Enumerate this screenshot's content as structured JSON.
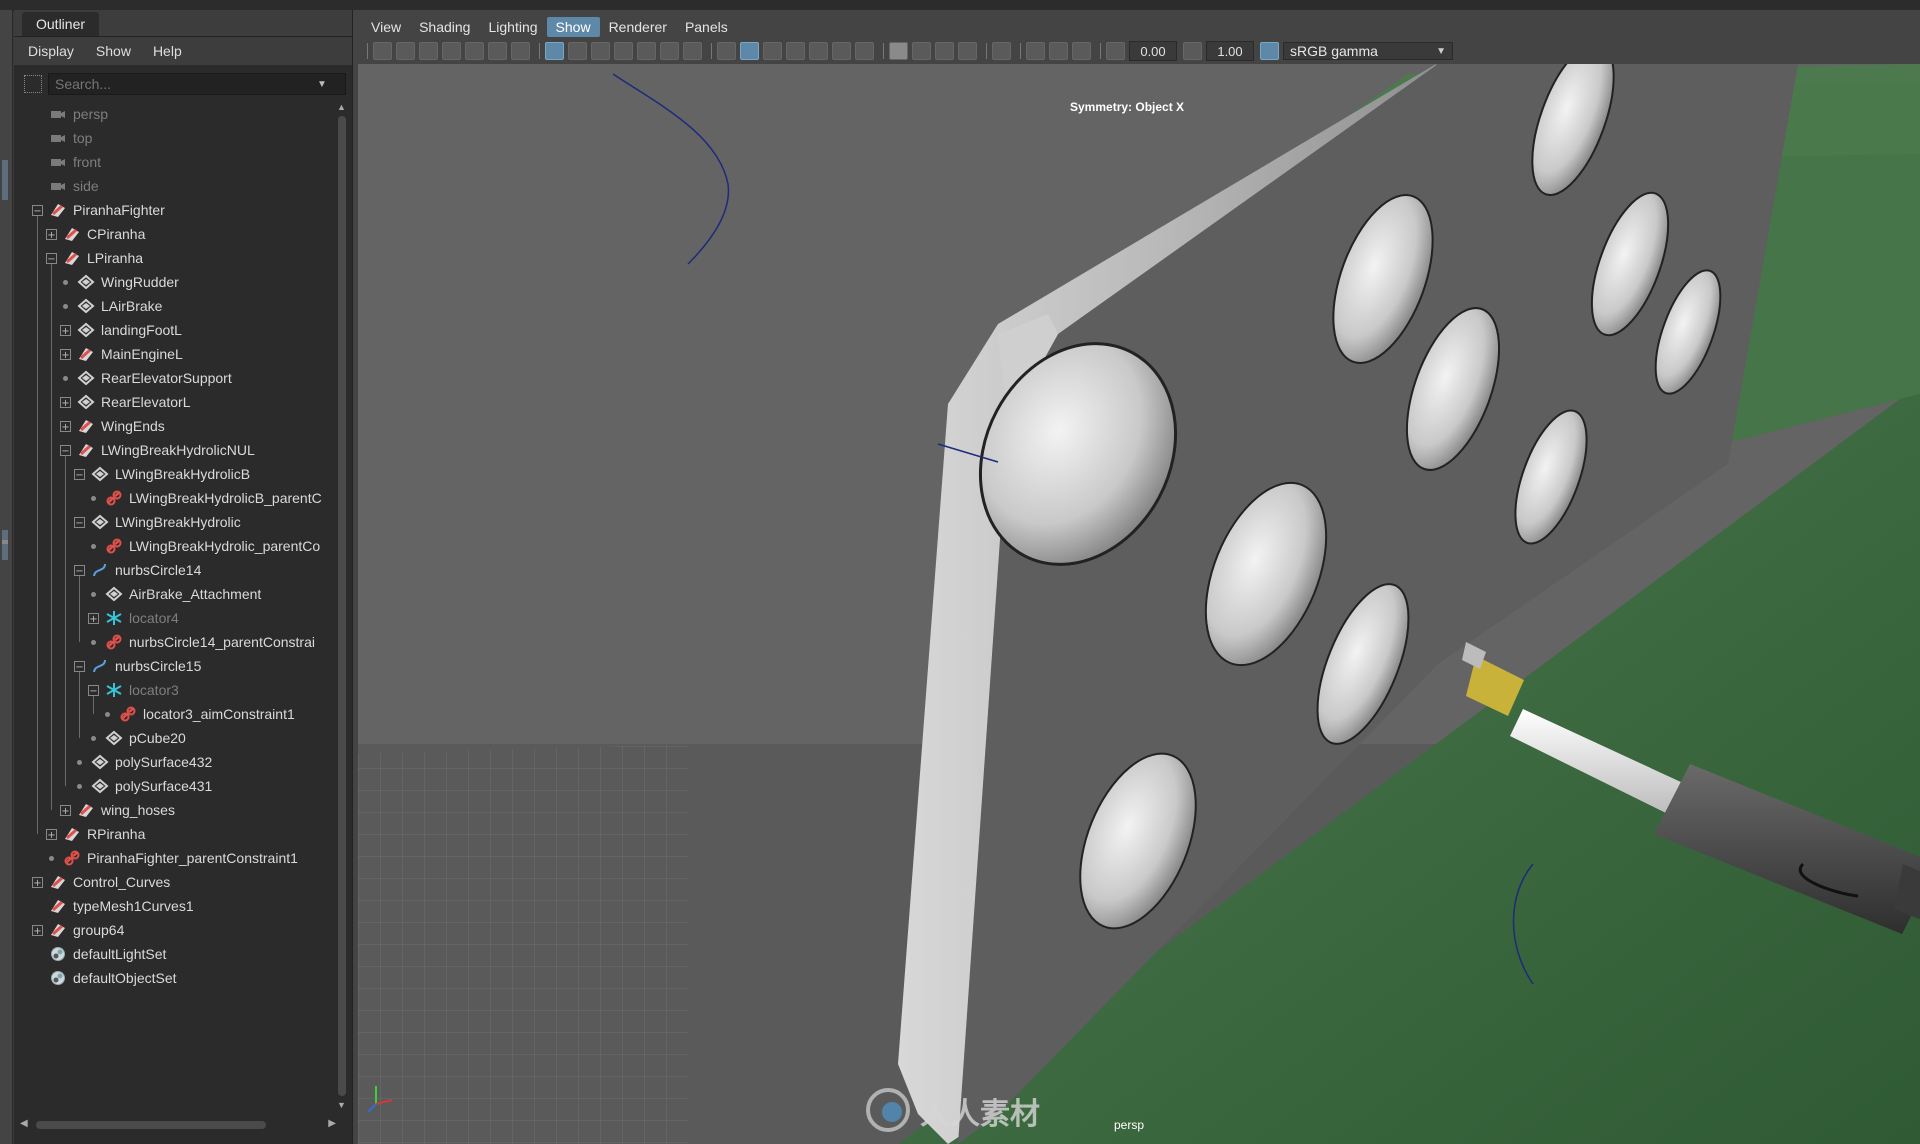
{
  "outliner": {
    "tab_title": "Outliner",
    "menus": [
      "Display",
      "Show",
      "Help"
    ],
    "search_placeholder": "Search...",
    "rows": [
      {
        "label": "persp",
        "icon": "camera",
        "level": 0,
        "expander": "none",
        "dim": true
      },
      {
        "label": "top",
        "icon": "camera",
        "level": 0,
        "expander": "none",
        "dim": true
      },
      {
        "label": "front",
        "icon": "camera",
        "level": 0,
        "expander": "none",
        "dim": true
      },
      {
        "label": "side",
        "icon": "camera",
        "level": 0,
        "expander": "none",
        "dim": true
      },
      {
        "label": "PiranhaFighter",
        "icon": "transform",
        "level": 0,
        "expander": "minus",
        "dim": false
      },
      {
        "label": "CPiranha",
        "icon": "transform",
        "level": 1,
        "expander": "plus",
        "dim": false
      },
      {
        "label": "LPiranha",
        "icon": "transform",
        "level": 1,
        "expander": "minus",
        "dim": false
      },
      {
        "label": "WingRudder",
        "icon": "mesh",
        "level": 2,
        "expander": "dot",
        "dim": false
      },
      {
        "label": "LAirBrake",
        "icon": "mesh",
        "level": 2,
        "expander": "dot",
        "dim": false
      },
      {
        "label": "landingFootL",
        "icon": "mesh",
        "level": 2,
        "expander": "plus",
        "dim": false
      },
      {
        "label": "MainEngineL",
        "icon": "transform",
        "level": 2,
        "expander": "plus",
        "dim": false
      },
      {
        "label": "RearElevatorSupport",
        "icon": "mesh",
        "level": 2,
        "expander": "dot",
        "dim": false
      },
      {
        "label": "RearElevatorL",
        "icon": "mesh",
        "level": 2,
        "expander": "plus",
        "dim": false
      },
      {
        "label": "WingEnds",
        "icon": "transform",
        "level": 2,
        "expander": "plus",
        "dim": false
      },
      {
        "label": "LWingBreakHydrolicNUL",
        "icon": "transform",
        "level": 2,
        "expander": "minus",
        "dim": false
      },
      {
        "label": "LWingBreakHydrolicB",
        "icon": "mesh",
        "level": 3,
        "expander": "minus",
        "dim": false
      },
      {
        "label": "LWingBreakHydrolicB_parentC",
        "icon": "constraint",
        "level": 4,
        "expander": "dot",
        "dim": false
      },
      {
        "label": "LWingBreakHydrolic",
        "icon": "mesh",
        "level": 3,
        "expander": "minus",
        "dim": false
      },
      {
        "label": "LWingBreakHydrolic_parentCo",
        "icon": "constraint",
        "level": 4,
        "expander": "dot",
        "dim": false
      },
      {
        "label": "nurbsCircle14",
        "icon": "curve",
        "level": 3,
        "expander": "minus",
        "dim": false
      },
      {
        "label": "AirBrake_Attachment",
        "icon": "mesh",
        "level": 4,
        "expander": "dot",
        "dim": false
      },
      {
        "label": "locator4",
        "icon": "locator",
        "level": 4,
        "expander": "plus",
        "dim": true
      },
      {
        "label": "nurbsCircle14_parentConstrai",
        "icon": "constraint",
        "level": 4,
        "expander": "dot",
        "dim": false
      },
      {
        "label": "nurbsCircle15",
        "icon": "curve",
        "level": 3,
        "expander": "minus",
        "dim": false
      },
      {
        "label": "locator3",
        "icon": "locator",
        "level": 4,
        "expander": "minus",
        "dim": true
      },
      {
        "label": "locator3_aimConstraint1",
        "icon": "constraint",
        "level": 5,
        "expander": "dot",
        "dim": false
      },
      {
        "label": "pCube20",
        "icon": "mesh",
        "level": 4,
        "expander": "dot",
        "dim": false
      },
      {
        "label": "polySurface432",
        "icon": "mesh",
        "level": 3,
        "expander": "dot",
        "dim": false
      },
      {
        "label": "polySurface431",
        "icon": "mesh",
        "level": 3,
        "expander": "dot",
        "dim": false
      },
      {
        "label": "wing_hoses",
        "icon": "transform",
        "level": 2,
        "expander": "plus",
        "dim": false
      },
      {
        "label": "RPiranha",
        "icon": "transform",
        "level": 1,
        "expander": "plus",
        "dim": false
      },
      {
        "label": "PiranhaFighter_parentConstraint1",
        "icon": "constraint",
        "level": 1,
        "expander": "dot",
        "dim": false
      },
      {
        "label": "Control_Curves",
        "icon": "transform",
        "level": 0,
        "expander": "plus",
        "dim": false
      },
      {
        "label": "typeMesh1Curves1",
        "icon": "transform",
        "level": 0,
        "expander": "none",
        "dim": false
      },
      {
        "label": "group64",
        "icon": "transform",
        "level": 0,
        "expander": "plus",
        "dim": false
      },
      {
        "label": "defaultLightSet",
        "icon": "set",
        "level": 0,
        "expander": "none",
        "dim": false
      },
      {
        "label": "defaultObjectSet",
        "icon": "set",
        "level": 0,
        "expander": "none",
        "dim": false
      }
    ]
  },
  "viewport_panel": {
    "menus": [
      "View",
      "Shading",
      "Lighting",
      "Show",
      "Renderer",
      "Panels"
    ],
    "active_menu": "Show",
    "exposure": "0.00",
    "gamma": "1.00",
    "color_space": "sRGB gamma",
    "symmetry_label": "Symmetry: Object X",
    "camera_label": "persp",
    "watermark": "人人素材"
  },
  "colors": {
    "accent": "#5e88a8",
    "constraint_icon": "#e0504a",
    "locator_icon": "#38c4d8",
    "curve_icon": "#5aa0e0",
    "ground_green": "#3f6a3f",
    "panel_grey": "#5a5a5a"
  }
}
